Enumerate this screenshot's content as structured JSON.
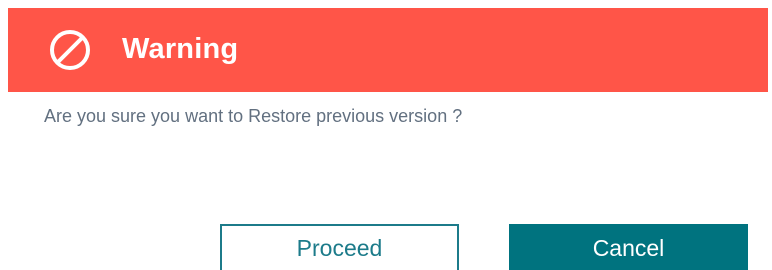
{
  "dialog": {
    "header": {
      "icon": "prohibited-icon",
      "title": "Warning",
      "background_color": "#ff5548"
    },
    "message": "Are you sure you want to Restore previous version ?",
    "buttons": {
      "proceed_label": "Proceed",
      "cancel_label": "Cancel"
    },
    "colors": {
      "accent": "#00737f",
      "message_text": "#627080"
    }
  }
}
